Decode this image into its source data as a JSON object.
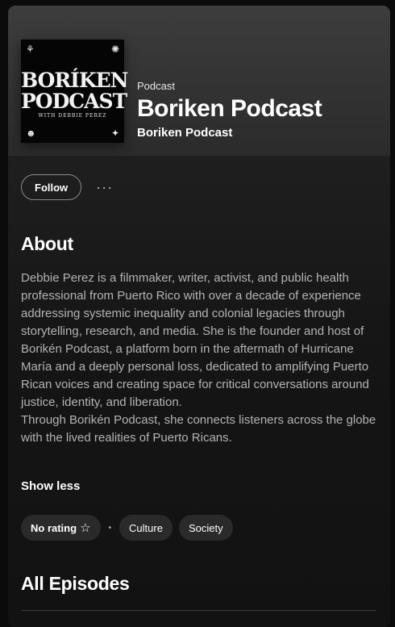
{
  "cover": {
    "title_line1": "BORÍKEN",
    "title_line2": "PODCAST",
    "byline": "WITH DEBBIE PEREZ"
  },
  "header": {
    "kind": "Podcast",
    "title": "Boriken Podcast",
    "publisher": "Boriken Podcast"
  },
  "actions": {
    "follow_label": "Follow",
    "more_label": "···"
  },
  "about": {
    "heading": "About",
    "paragraphs": [
      "Debbie Perez is a filmmaker, writer, activist, and public health professional from Puerto Rico with over a decade of experience addressing systemic inequality and colonial legacies through storytelling, research, and media. She is the founder and host of Borikén Podcast, a platform born in the aftermath of Hurricane María and a deeply personal loss, dedicated to amplifying Puerto Rican voices and creating space for critical conversations around justice, identity, and liberation.",
      "Through Borikén Podcast, she connects listeners across the globe with the lived realities of Puerto Ricans."
    ],
    "toggle_label": "Show less"
  },
  "tags": {
    "rating_label": "No rating",
    "separator": "•",
    "categories": [
      "Culture",
      "Society"
    ]
  },
  "episodes": {
    "heading": "All Episodes"
  },
  "icons": {
    "star": "star-outline-icon",
    "more": "more-horizontal-icon"
  },
  "colors": {
    "background": "#121212",
    "hero": "#3d3d3d",
    "text_secondary": "#b3b3b3",
    "chip": "#2a2a2a"
  }
}
